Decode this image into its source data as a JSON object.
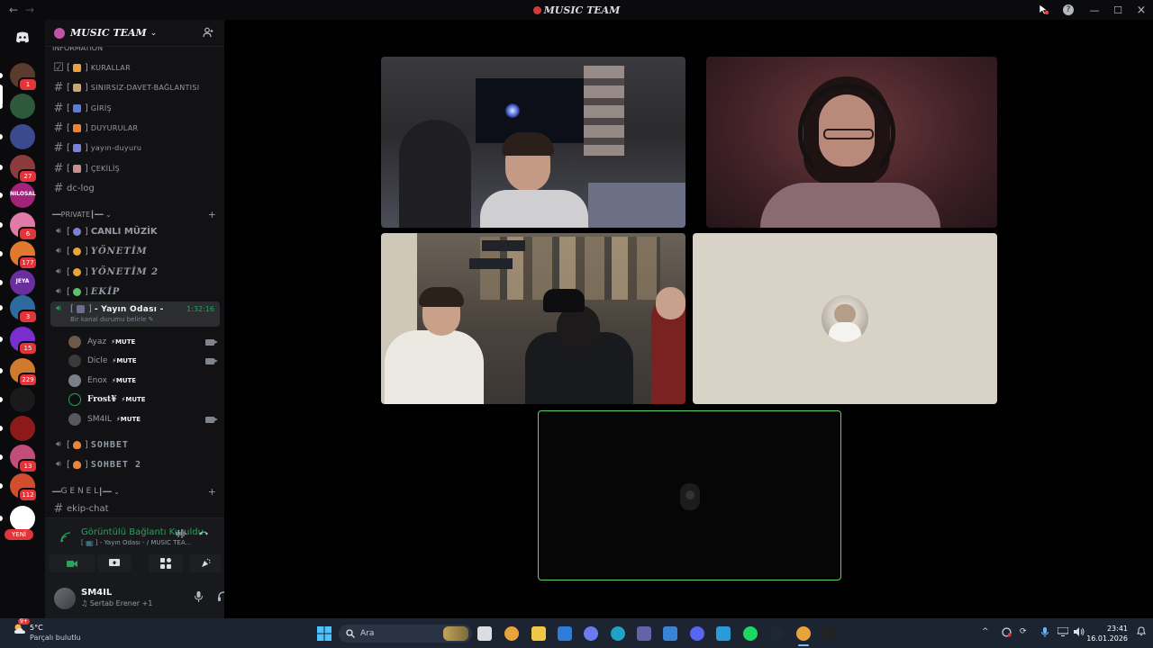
{
  "window": {
    "title": "MUSIC TEAM",
    "back": "←",
    "forward": "→",
    "help": "?"
  },
  "rail": {
    "servers": [
      {
        "name": "discord-home",
        "color": "#5865f2"
      },
      {
        "name": "server-1",
        "color": "#5a3b2e",
        "badge": "1"
      },
      {
        "name": "server-2",
        "color": "#2e5a3b"
      },
      {
        "name": "server-3",
        "color": "#3b4a8c"
      },
      {
        "name": "server-4",
        "color": "#8c3b3b",
        "badge": "27"
      },
      {
        "name": "server-5",
        "color": "#a1237a",
        "label": "NILOSAL"
      },
      {
        "name": "server-6",
        "color": "#e07aa8",
        "badge": "6"
      },
      {
        "name": "server-7",
        "color": "#e0792e",
        "badge": "177"
      },
      {
        "name": "server-8",
        "color": "#6a2e9e",
        "label": "JEYA"
      },
      {
        "name": "server-9",
        "color": "#2e6a9e",
        "badge": "3"
      },
      {
        "name": "server-10",
        "color": "#7a2ed0",
        "badge": "15"
      },
      {
        "name": "server-11",
        "color": "#d07a2e",
        "badge": "229"
      },
      {
        "name": "server-12",
        "color": "#1a1a1a"
      },
      {
        "name": "server-13",
        "color": "#8c1a1a"
      },
      {
        "name": "server-14",
        "color": "#c04e78",
        "badge": "13"
      },
      {
        "name": "server-15",
        "color": "#d04e2e",
        "badge": "112"
      },
      {
        "name": "server-16",
        "color": "#ffffff",
        "badge": "YENİ"
      }
    ]
  },
  "guild": {
    "name": "MUSIC TEAM",
    "chevron": "⌄",
    "invite_icon": "👤+"
  },
  "channels": {
    "top_partial": "INFORMATION",
    "info": [
      {
        "prefix": "[",
        "label": "KURALLAR",
        "icon": "checkbox"
      },
      {
        "prefix": "[",
        "label": "SINIRSIZ-DAVET-BAĞLANTISI",
        "icon": "hash"
      },
      {
        "prefix": "[",
        "label": "GİRİŞ",
        "icon": "hash"
      },
      {
        "prefix": "[",
        "label": "DUYURULAR",
        "icon": "hash"
      },
      {
        "prefix": "[",
        "label": "yayın-duyuru",
        "icon": "hash"
      },
      {
        "prefix": "[",
        "label": "ÇEKİLİŞ",
        "icon": "hash"
      },
      {
        "prefix": "",
        "label": "dc-log",
        "icon": "hash"
      }
    ],
    "private_category": "PRIVATE",
    "private": [
      {
        "label": "CANLI MÜZİK",
        "style": "big"
      },
      {
        "label": "YÖNETİM",
        "style": "ital"
      },
      {
        "label": "YÖNETİM 2",
        "style": "ital"
      },
      {
        "label": "EKİP",
        "style": "ital"
      }
    ],
    "active": {
      "label": "- Yayın Odası -",
      "timer": "1:32:16",
      "sub": "Bir kanal durumu belirle ✎"
    },
    "voice_users": [
      {
        "name": "Ayaz",
        "tag": "⚡MUTE",
        "cam": true
      },
      {
        "name": "Dicle",
        "tag": "⚡MUTE",
        "cam": true
      },
      {
        "name": "Enox",
        "tag": "⚡MUTE",
        "cam": false
      },
      {
        "name": "Frost¥",
        "tag": "⚡MUTE",
        "cam": false
      },
      {
        "name": "SM4IL",
        "tag": "⚡MUTE",
        "cam": true
      }
    ],
    "after_voice": [
      {
        "label": "SOHBET"
      },
      {
        "label": "SOHBET 2"
      }
    ],
    "genel_category": "G E N E L",
    "genel": [
      {
        "label": "ekip-chat"
      }
    ]
  },
  "voice_panel": {
    "status": "Görüntülü Bağlantı Kuruldu",
    "channel": "[ 📺 ] - Yayın Odası - / MUSIC TEA..."
  },
  "user": {
    "name": "SM4IL",
    "status": "♫ Sertab Erener +1"
  },
  "taskbar": {
    "temp": "5°C",
    "weather_desc": "Parçalı bulutlu",
    "weather_badge": "9+",
    "search_placeholder": "Ara",
    "time": "23:41",
    "date": "16.01.2026"
  }
}
